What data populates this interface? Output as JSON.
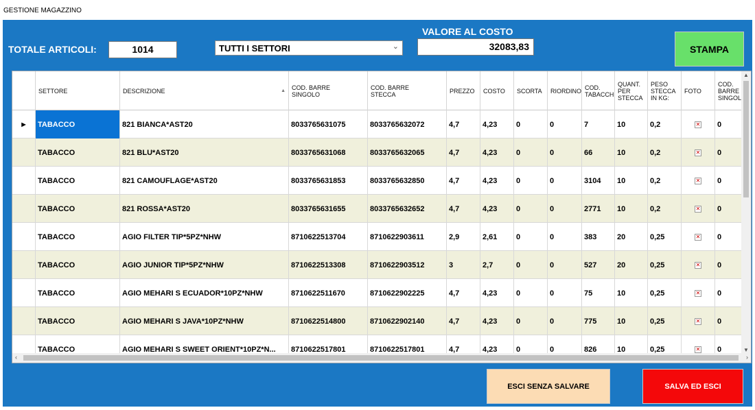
{
  "window": {
    "title": "GESTIONE MAGAZZINO"
  },
  "totale": {
    "label": "TOTALE ARTICOLI:",
    "value": "1014"
  },
  "settori": {
    "selected": "TUTTI I SETTORI"
  },
  "valore": {
    "label": "VALORE AL COSTO",
    "value": "32083,83"
  },
  "buttons": {
    "stampa": "STAMPA",
    "esci": "ESCI SENZA SALVARE",
    "salva": "SALVA ED ESCI"
  },
  "icons": {
    "dropdown": "chevron-down-icon",
    "sort": "sort-ascending-icon",
    "foto": "broken-image-icon",
    "row_indicator": "current-row-arrow-icon"
  },
  "colors": {
    "panel": "#1b78c4",
    "stampa": "#68e06a",
    "esci": "#fcdcb4",
    "salva": "#f4080a",
    "row_alt": "#f0f0dc",
    "selection": "#0a73d4"
  },
  "table": {
    "columns": [
      "SETTORE",
      "DESCRIZIONE",
      "COD. BARRE\nSINGOLO",
      "COD. BARRE\nSTECCA",
      "PREZZO",
      "COSTO",
      "SCORTA",
      "RIORDINO",
      "COD.\nTABACCHI",
      "QUANT.\nPER\nSTECCA",
      "PESO\nSTECCA\nIN KG:",
      "FOTO",
      "COD. BARRE\nSINGOLO"
    ],
    "rows": [
      [
        "TABACCO",
        "821 BIANCA*AST20",
        "8033765631075",
        "8033765632072",
        "4,7",
        "4,23",
        "0",
        "0",
        "7",
        "10",
        "0,2",
        "",
        "0"
      ],
      [
        "TABACCO",
        "821 BLU*AST20",
        "8033765631068",
        "8033765632065",
        "4,7",
        "4,23",
        "0",
        "0",
        "66",
        "10",
        "0,2",
        "",
        "0"
      ],
      [
        "TABACCO",
        "821 CAMOUFLAGE*AST20",
        "8033765631853",
        "8033765632850",
        "4,7",
        "4,23",
        "0",
        "0",
        "3104",
        "10",
        "0,2",
        "",
        "0"
      ],
      [
        "TABACCO",
        "821 ROSSA*AST20",
        "8033765631655",
        "8033765632652",
        "4,7",
        "4,23",
        "0",
        "0",
        "2771",
        "10",
        "0,2",
        "",
        "0"
      ],
      [
        "TABACCO",
        "AGIO FILTER TIP*5PZ*NHW",
        "8710622513704",
        "8710622903611",
        "2,9",
        "2,61",
        "0",
        "0",
        "383",
        "20",
        "0,25",
        "",
        "0"
      ],
      [
        "TABACCO",
        "AGIO JUNIOR TIP*5PZ*NHW",
        "8710622513308",
        "8710622903512",
        "3",
        "2,7",
        "0",
        "0",
        "527",
        "20",
        "0,25",
        "",
        "0"
      ],
      [
        "TABACCO",
        "AGIO MEHARI S ECUADOR*10PZ*NHW",
        "8710622511670",
        "8710622902225",
        "4,7",
        "4,23",
        "0",
        "0",
        "75",
        "10",
        "0,25",
        "",
        "0"
      ],
      [
        "TABACCO",
        "AGIO MEHARI S JAVA*10PZ*NHW",
        "8710622514800",
        "8710622902140",
        "4,7",
        "4,23",
        "0",
        "0",
        "775",
        "10",
        "0,25",
        "",
        "0"
      ],
      [
        "TABACCO",
        "AGIO MEHARI S SWEET ORIENT*10PZ*N...",
        "8710622517801",
        "8710622517801",
        "4,7",
        "4,23",
        "0",
        "0",
        "826",
        "10",
        "0,25",
        "",
        "0"
      ]
    ]
  }
}
